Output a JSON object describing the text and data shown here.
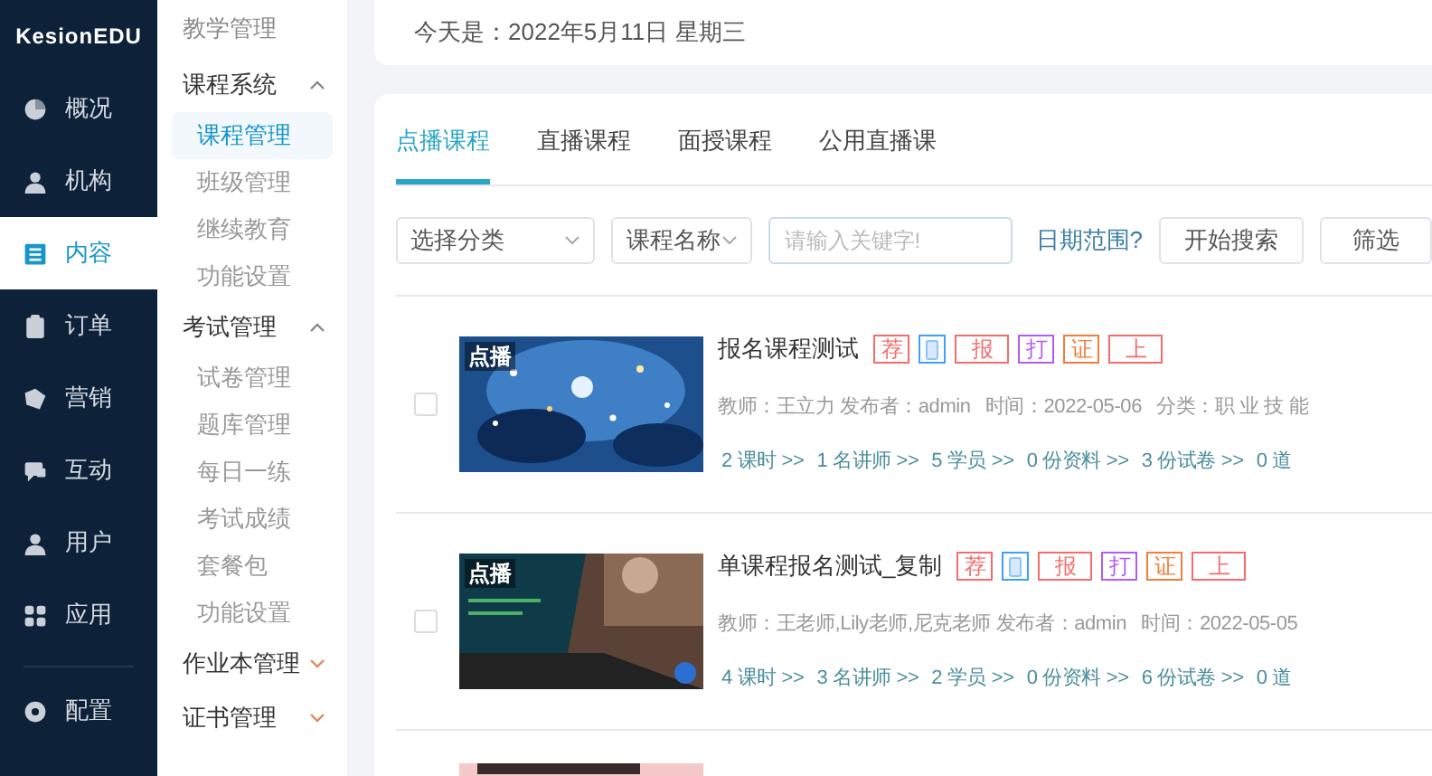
{
  "logo": "KesionEDU",
  "main_nav": [
    {
      "label": "概况",
      "selected": false
    },
    {
      "label": "机构",
      "selected": false
    },
    {
      "label": "内容",
      "selected": true
    },
    {
      "label": "订单",
      "selected": false
    },
    {
      "label": "营销",
      "selected": false
    },
    {
      "label": "互动",
      "selected": false
    },
    {
      "label": "用户",
      "selected": false
    },
    {
      "label": "应用",
      "selected": false
    },
    {
      "label": "配置",
      "selected": false
    }
  ],
  "sub_nav": {
    "title": "教学管理",
    "groups": [
      {
        "label": "课程系统",
        "expanded": true,
        "items": [
          {
            "label": "课程管理",
            "selected": true
          },
          {
            "label": "班级管理",
            "selected": false
          },
          {
            "label": "继续教育",
            "selected": false
          },
          {
            "label": "功能设置",
            "selected": false
          }
        ]
      },
      {
        "label": "考试管理",
        "expanded": true,
        "items": [
          {
            "label": "试卷管理",
            "selected": false
          },
          {
            "label": "题库管理",
            "selected": false
          },
          {
            "label": "每日一练",
            "selected": false
          },
          {
            "label": "考试成绩",
            "selected": false
          },
          {
            "label": "套餐包",
            "selected": false
          },
          {
            "label": "功能设置",
            "selected": false
          }
        ]
      },
      {
        "label": "作业本管理",
        "expanded": false
      },
      {
        "label": "证书管理",
        "expanded": false
      }
    ]
  },
  "date_text": "今天是：2022年5月11日 星期三",
  "tabs": [
    {
      "label": "点播课程",
      "selected": true
    },
    {
      "label": "直播课程",
      "selected": false
    },
    {
      "label": "面授课程",
      "selected": false
    },
    {
      "label": "公用直播课",
      "selected": false
    }
  ],
  "filters": {
    "category": "选择分类",
    "field": "课程名称",
    "keyword_placeholder": "请输入关键字!",
    "date_range": "日期范围?",
    "search_button": "开始搜索",
    "filter_button": "筛选"
  },
  "courses": [
    {
      "badge": "点播",
      "title": "报名课程测试",
      "checked": false,
      "tags": [
        {
          "kind": "text",
          "label": "荐",
          "color": "#f56c6c"
        },
        {
          "kind": "icon",
          "color": "#409eff"
        },
        {
          "kind": "text",
          "label": "报",
          "color": "#f56c6c"
        },
        {
          "kind": "text",
          "label": "打",
          "color": "#b25cf5"
        },
        {
          "kind": "text",
          "label": "证",
          "color": "#f27c3c"
        },
        {
          "kind": "text",
          "label": "上",
          "color": "#f56c6c"
        }
      ],
      "meta": [
        "教师：王立力 发布者：admin",
        "时间：2022-05-06",
        "分类：职 业 技 能"
      ],
      "links": [
        "2 课时 >>",
        "1 名讲师 >>",
        "5 学员 >>",
        "0 份资料 >>",
        "3 份试卷 >>",
        "0 道"
      ]
    },
    {
      "badge": "点播",
      "title": "单课程报名测试_复制",
      "checked": false,
      "tags": [
        {
          "kind": "text",
          "label": "荐",
          "color": "#f56c6c"
        },
        {
          "kind": "icon",
          "color": "#409eff"
        },
        {
          "kind": "text",
          "label": "报",
          "color": "#f56c6c"
        },
        {
          "kind": "text",
          "label": "打",
          "color": "#b25cf5"
        },
        {
          "kind": "text",
          "label": "证",
          "color": "#f27c3c"
        },
        {
          "kind": "text",
          "label": "上",
          "color": "#f56c6c"
        }
      ],
      "meta": [
        "教师：王老师,Lily老师,尼克老师 发布者：admin",
        "时间：2022-05-05"
      ],
      "links": [
        "4 课时 >>",
        "3 名讲师 >>",
        "2 学员 >>",
        "0 份资料 >>",
        "6 份试卷 >>",
        "0 道"
      ]
    }
  ]
}
